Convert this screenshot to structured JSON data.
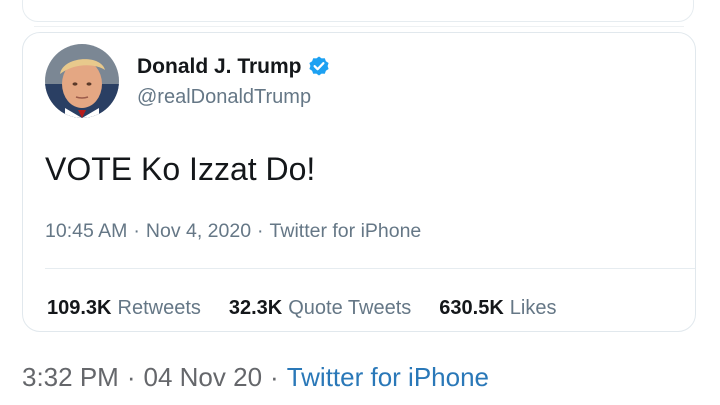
{
  "tweet": {
    "display_name": "Donald J. Trump",
    "handle": "@realDonaldTrump",
    "text": "VOTE Ko Izzat Do!",
    "time": "10:45 AM",
    "date": "Nov 4, 2020",
    "source": "Twitter for iPhone",
    "separator": "·",
    "verified": true,
    "stats": {
      "retweets_count": "109.3K",
      "retweets_label": "Retweets",
      "quote_tweets_count": "32.3K",
      "quote_tweets_label": "Quote Tweets",
      "likes_count": "630.5K",
      "likes_label": "Likes"
    }
  },
  "post_meta": {
    "time": "3:32 PM",
    "date": "04 Nov 20",
    "source": "Twitter for iPhone",
    "separator": "·"
  },
  "colors": {
    "text_primary": "#14171a",
    "text_secondary": "#657786",
    "verified_blue": "#1da1f2",
    "link_blue": "#2a78b8",
    "border": "#e1e8ed"
  },
  "icons": {
    "verified": "verified-badge-icon",
    "avatar": "profile-photo"
  }
}
